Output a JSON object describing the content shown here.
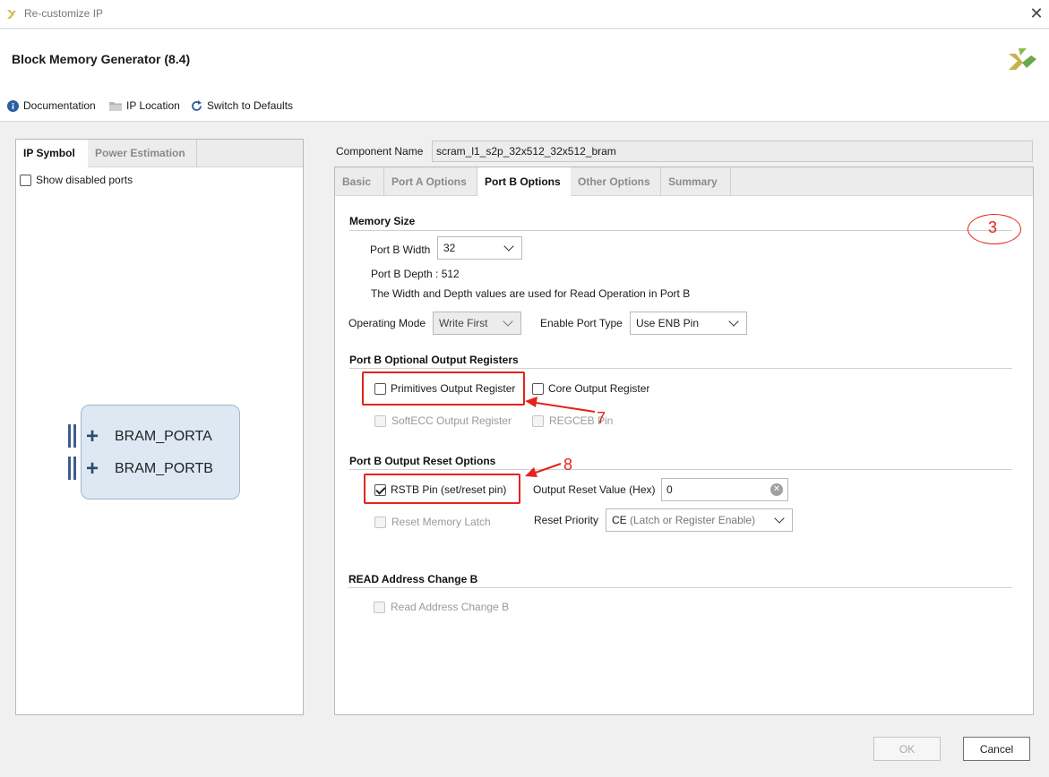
{
  "window": {
    "title": "Re-customize IP",
    "close_glyph": "✕"
  },
  "header": {
    "title": "Block Memory Generator (8.4)",
    "toolbar": {
      "documentation": "Documentation",
      "ip_location": "IP Location",
      "switch_defaults": "Switch to Defaults"
    }
  },
  "left": {
    "tabs": [
      "IP Symbol",
      "Power Estimation"
    ],
    "show_disabled_ports": "Show disabled ports",
    "symbol": {
      "ports": [
        "BRAM_PORTA",
        "BRAM_PORTB"
      ],
      "plus": "+"
    }
  },
  "component": {
    "label": "Component Name",
    "value": "scram_l1_s2p_32x512_32x512_bram"
  },
  "tabs": [
    "Basic",
    "Port A Options",
    "Port B Options",
    "Other Options",
    "Summary"
  ],
  "active_tab": "Port B Options",
  "memory_size": {
    "title": "Memory Size",
    "port_b_width_label": "Port B Width",
    "port_b_width_value": "32",
    "port_b_depth": "Port B Depth : 512",
    "note": "The Width and Depth values are used for Read Operation in Port B",
    "operating_mode_label": "Operating Mode",
    "operating_mode_value": "Write First",
    "enable_port_type_label": "Enable Port Type",
    "enable_port_type_value": "Use ENB Pin"
  },
  "output_registers": {
    "title": "Port B Optional Output Registers",
    "primitives": "Primitives Output Register",
    "core": "Core Output Register",
    "softecc": "SoftECC Output Register",
    "regceb": "REGCEB Pin"
  },
  "reset_options": {
    "title": "Port B Output Reset Options",
    "rstb": "RSTB Pin (set/reset pin)",
    "output_reset_value_label": "Output Reset Value (Hex)",
    "output_reset_value": "0",
    "reset_memory_latch": "Reset Memory Latch",
    "reset_priority_label": "Reset Priority",
    "reset_priority_value": "CE",
    "reset_priority_hint": "(Latch or Register Enable)"
  },
  "read_address": {
    "title": "READ Address Change B",
    "checkbox": "Read Address Change B"
  },
  "annotations": {
    "n3": "3",
    "n7": "7",
    "n8": "8"
  },
  "buttons": {
    "ok": "OK",
    "cancel": "Cancel"
  },
  "colors": {
    "annotation_red": "#e3231c",
    "symbol_fill": "#dde8f3",
    "accent_blue": "#2d4a70"
  }
}
